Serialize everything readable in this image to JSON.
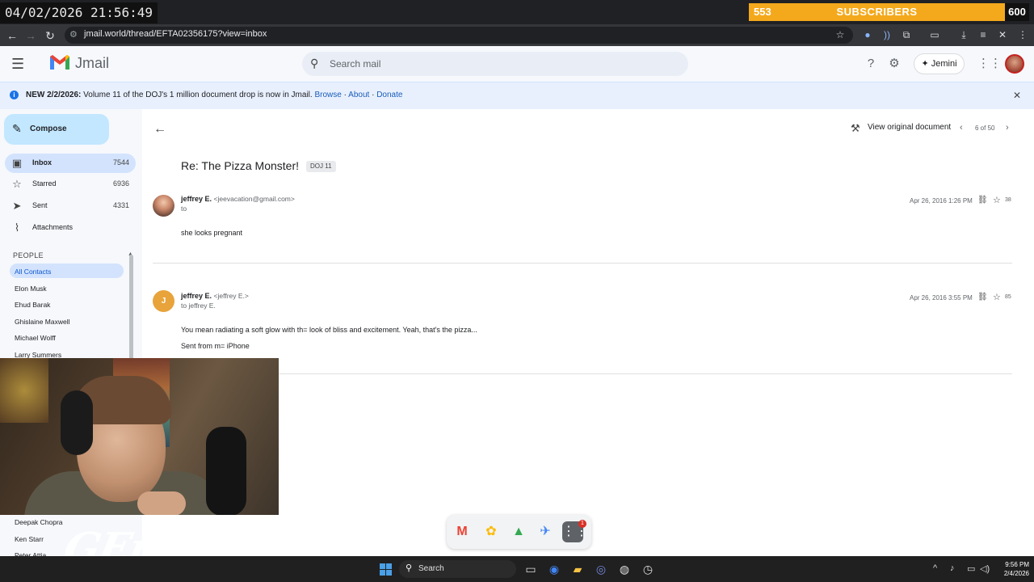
{
  "overlay": {
    "timestamp": "04/02/2026 21:56:49",
    "subscribers_count": "553",
    "subscribers_label": "SUBSCRIBERS",
    "subscribers_goal": "600"
  },
  "browser": {
    "url": "jmail.world/thread/EFTA02356175?view=inbox"
  },
  "header": {
    "app_name": "Jmail",
    "search_placeholder": "Search mail",
    "jemini_label": "Jemini"
  },
  "banner": {
    "prefix": "NEW 2/2/2026:",
    "text": " Volume 11 of the DOJ's 1 million document drop is now in Jmail.",
    "links": [
      "Browse",
      "About",
      "Donate"
    ]
  },
  "sidebar": {
    "compose_label": "Compose",
    "nav": [
      {
        "label": "Inbox",
        "count": "7544",
        "icon": "inbox-icon"
      },
      {
        "label": "Starred",
        "count": "6936",
        "icon": "star-icon"
      },
      {
        "label": "Sent",
        "count": "4331",
        "icon": "send-icon"
      },
      {
        "label": "Attachments",
        "count": "",
        "icon": "paperclip-icon"
      }
    ],
    "people_header": "PEOPLE",
    "contacts": [
      "All Contacts",
      "Elon Musk",
      "Ehud Barak",
      "Ghislaine Maxwell",
      "Michael Wolff",
      "Larry Summers",
      "Deepak Chopra",
      "Ken Starr",
      "Peter Attia"
    ]
  },
  "thread": {
    "view_original": "View original document",
    "pager": "6 of 50",
    "subject": "Re: The Pizza Monster!",
    "label": "DOJ 11",
    "messages": [
      {
        "sender": "jeffrey E.",
        "address": "<jeevacation@gmail.com>",
        "to": "to",
        "date": "Apr 26, 2016 1:26 PM",
        "num": "38",
        "body": "she looks pregnant",
        "signature": ""
      },
      {
        "sender": "jeffrey E.",
        "address": "<jeffrey E.>",
        "to": "to jeffrey E.",
        "avatar_letter": "J",
        "date": "Apr 26, 2016 3:55 PM",
        "num": "85",
        "body": "You mean radiating a soft glow with th= look of bliss and excitement. Yeah, that's the pizza...",
        "signature": "Sent from m= iPhone"
      }
    ]
  },
  "dock": {
    "badge": "1"
  },
  "taskbar": {
    "search_label": "Search",
    "time": "9:56 PM",
    "date": "2/4/2026"
  },
  "colors": {
    "accent": "#1a73e8",
    "compose_bg": "#c2e7ff",
    "active_nav": "#d3e3fd",
    "subscriber_bar": "#f4a91c"
  }
}
